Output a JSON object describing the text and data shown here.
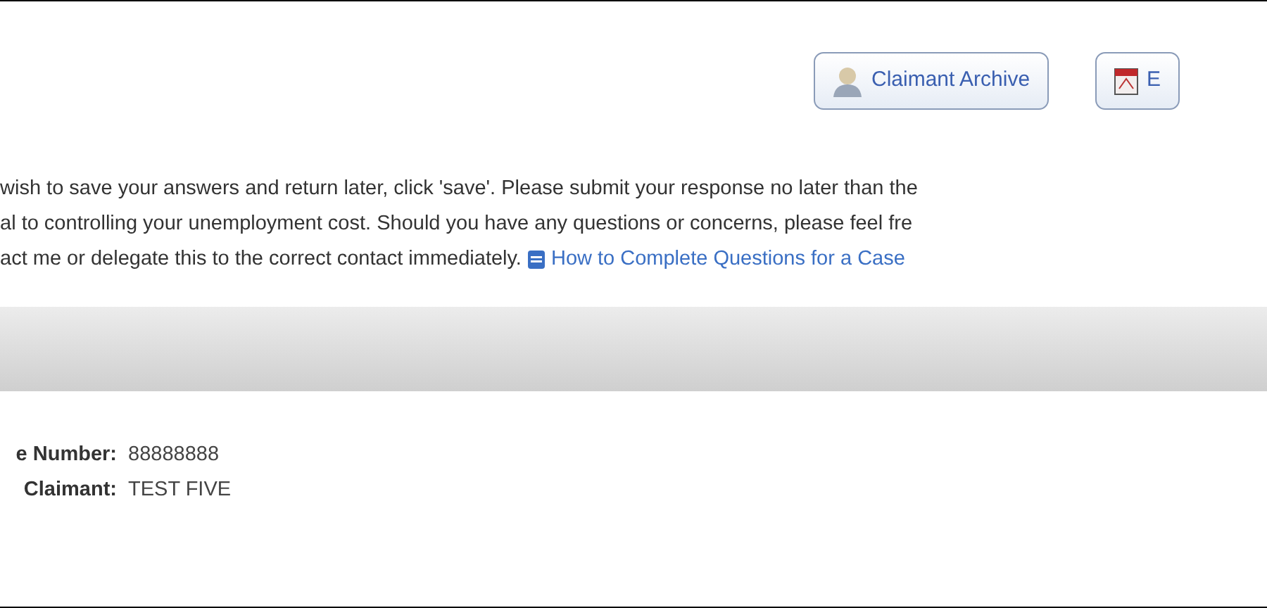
{
  "buttons": [
    {
      "label": "Claimant Archive",
      "kind": "person"
    },
    {
      "label": "E",
      "kind": "pdf"
    }
  ],
  "instructions": [
    "wish to save your answers and return later, click 'save'. Please submit your response no later than the",
    "al to controlling your unemployment cost. Should you have any questions or concerns, please feel fre",
    "act me or delegate this to the correct contact immediately."
  ],
  "help_link": "How to Complete Questions for a Case",
  "fields": [
    {
      "label": "e Number:",
      "value": "88888888"
    },
    {
      "label": "Claimant:",
      "value": "TEST FIVE"
    }
  ]
}
